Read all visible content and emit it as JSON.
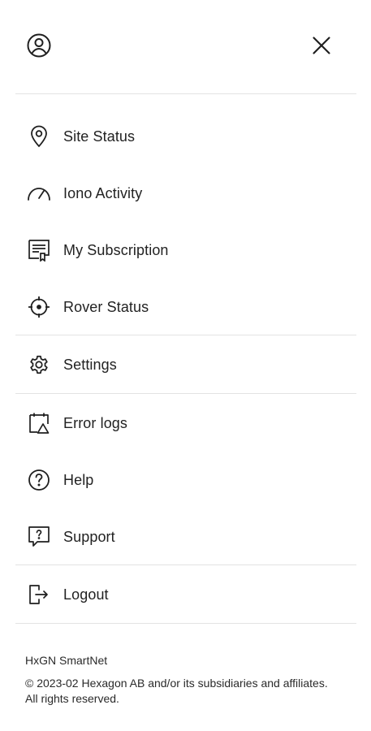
{
  "header": {
    "profile_icon": "account-circle-icon",
    "close_icon": "close-icon"
  },
  "menu": {
    "group1": [
      {
        "label": "Site Status",
        "icon": "location-pin-icon"
      },
      {
        "label": "Iono Activity",
        "icon": "speedometer-icon"
      },
      {
        "label": "My Subscription",
        "icon": "receipt-icon"
      },
      {
        "label": "Rover Status",
        "icon": "crosshair-icon"
      }
    ],
    "group2": [
      {
        "label": "Settings",
        "icon": "gear-icon"
      }
    ],
    "group3": [
      {
        "label": "Error logs",
        "icon": "calendar-warning-icon"
      },
      {
        "label": "Help",
        "icon": "question-circle-icon"
      },
      {
        "label": "Support",
        "icon": "support-chat-icon"
      }
    ],
    "group4": [
      {
        "label": "Logout",
        "icon": "logout-icon"
      }
    ]
  },
  "footer": {
    "title": "HxGN SmartNet",
    "copyright": "© 2023-02 Hexagon AB and/or its subsidiaries and affiliates. All rights reserved."
  }
}
